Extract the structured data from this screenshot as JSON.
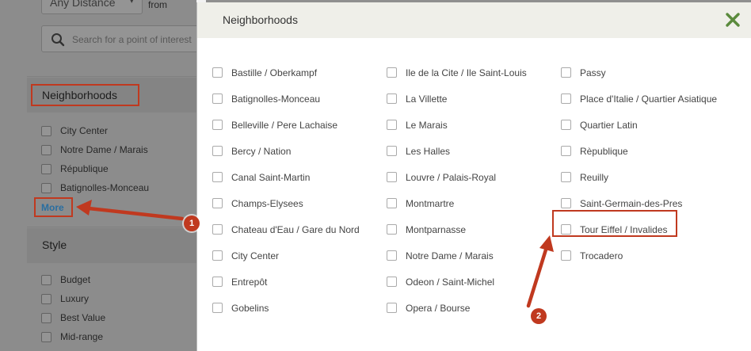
{
  "sidebar": {
    "distance_select": "Any Distance",
    "from_label": "from",
    "search_placeholder": "Search for a point of interest",
    "neighborhoods_heading": "Neighborhoods",
    "neighborhood_items": [
      "City Center",
      "Notre Dame / Marais",
      "République",
      "Batignolles-Monceau"
    ],
    "more_link": "More",
    "style_heading": "Style",
    "style_items": [
      "Budget",
      "Luxury",
      "Best Value",
      "Mid-range"
    ]
  },
  "modal": {
    "title": "Neighborhoods",
    "close_icon": "close-icon",
    "columns": [
      [
        "Bastille / Oberkampf",
        "Batignolles-Monceau",
        "Belleville / Pere Lachaise",
        "Bercy / Nation",
        "Canal Saint-Martin",
        "Champs-Elysees",
        "Chateau d'Eau / Gare du Nord",
        "City Center",
        "Entrepôt",
        "Gobelins"
      ],
      [
        "Ile de la Cite / Ile Saint-Louis",
        "La Villette",
        "Le Marais",
        "Les Halles",
        "Louvre / Palais-Royal",
        "Montmartre",
        "Montparnasse",
        "Notre Dame / Marais",
        "Odeon / Saint-Michel",
        "Opera / Bourse"
      ],
      [
        "Passy",
        "Place d'Italie / Quartier Asiatique",
        "Quartier Latin",
        "Rèpublique",
        "Reuilly",
        "Saint-Germain-des-Pres",
        "Tour Eiffel / Invalides",
        "Trocadero"
      ]
    ]
  },
  "annotations": {
    "badge_1": "1",
    "badge_2": "2",
    "accent_color": "#c0391f"
  }
}
